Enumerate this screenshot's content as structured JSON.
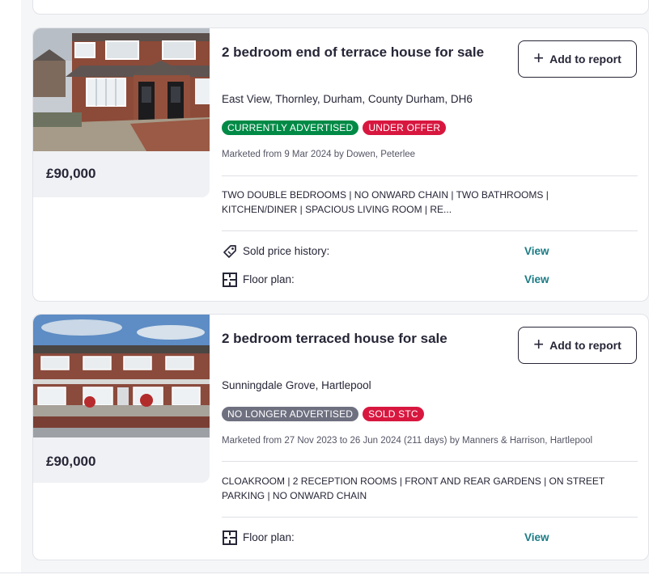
{
  "colors": {
    "advertised": "#008a46",
    "under_offer": "#d8173f",
    "no_longer": "#6e7080",
    "sold_stc": "#d8173f",
    "link": "#1a7b84"
  },
  "listings": [
    {
      "title": "2 bedroom end of terrace house for sale",
      "add_label": "Add to report",
      "add_icon": "plus-icon",
      "address": "East View, Thornley, Durham, County Durham, DH6",
      "badges": [
        "CURRENTLY ADVERTISED",
        "UNDER OFFER"
      ],
      "marketed": "Marketed from 9 Mar 2024 by Dowen, Peterlee",
      "summary": "TWO DOUBLE BEDROOMS | NO ONWARD CHAIN | TWO BATHROOMS | KITCHEN/DINER | SPACIOUS LIVING ROOM | RE...",
      "price": "£90,000",
      "rows": [
        {
          "label": "Sold price history:",
          "link": "View",
          "icon": "price-tag-icon"
        },
        {
          "label": "Floor plan:",
          "link": "View",
          "icon": "floor-plan-icon"
        }
      ]
    },
    {
      "title": "2 bedroom terraced house for sale",
      "add_label": "Add to report",
      "add_icon": "plus-icon",
      "address": "Sunningdale Grove, Hartlepool",
      "badges": [
        "NO LONGER ADVERTISED",
        "SOLD STC"
      ],
      "marketed": "Marketed from 27 Nov 2023 to 26 Jun 2024 (211 days) by Manners & Harrison, Hartlepool",
      "summary": "CLOAKROOM | 2 RECEPTION ROOMS | FRONT AND REAR GARDENS | ON STREET PARKING | NO ONWARD CHAIN",
      "price": "£90,000",
      "rows": [
        {
          "label": "Floor plan:",
          "link": "View",
          "icon": "floor-plan-icon"
        }
      ]
    }
  ]
}
